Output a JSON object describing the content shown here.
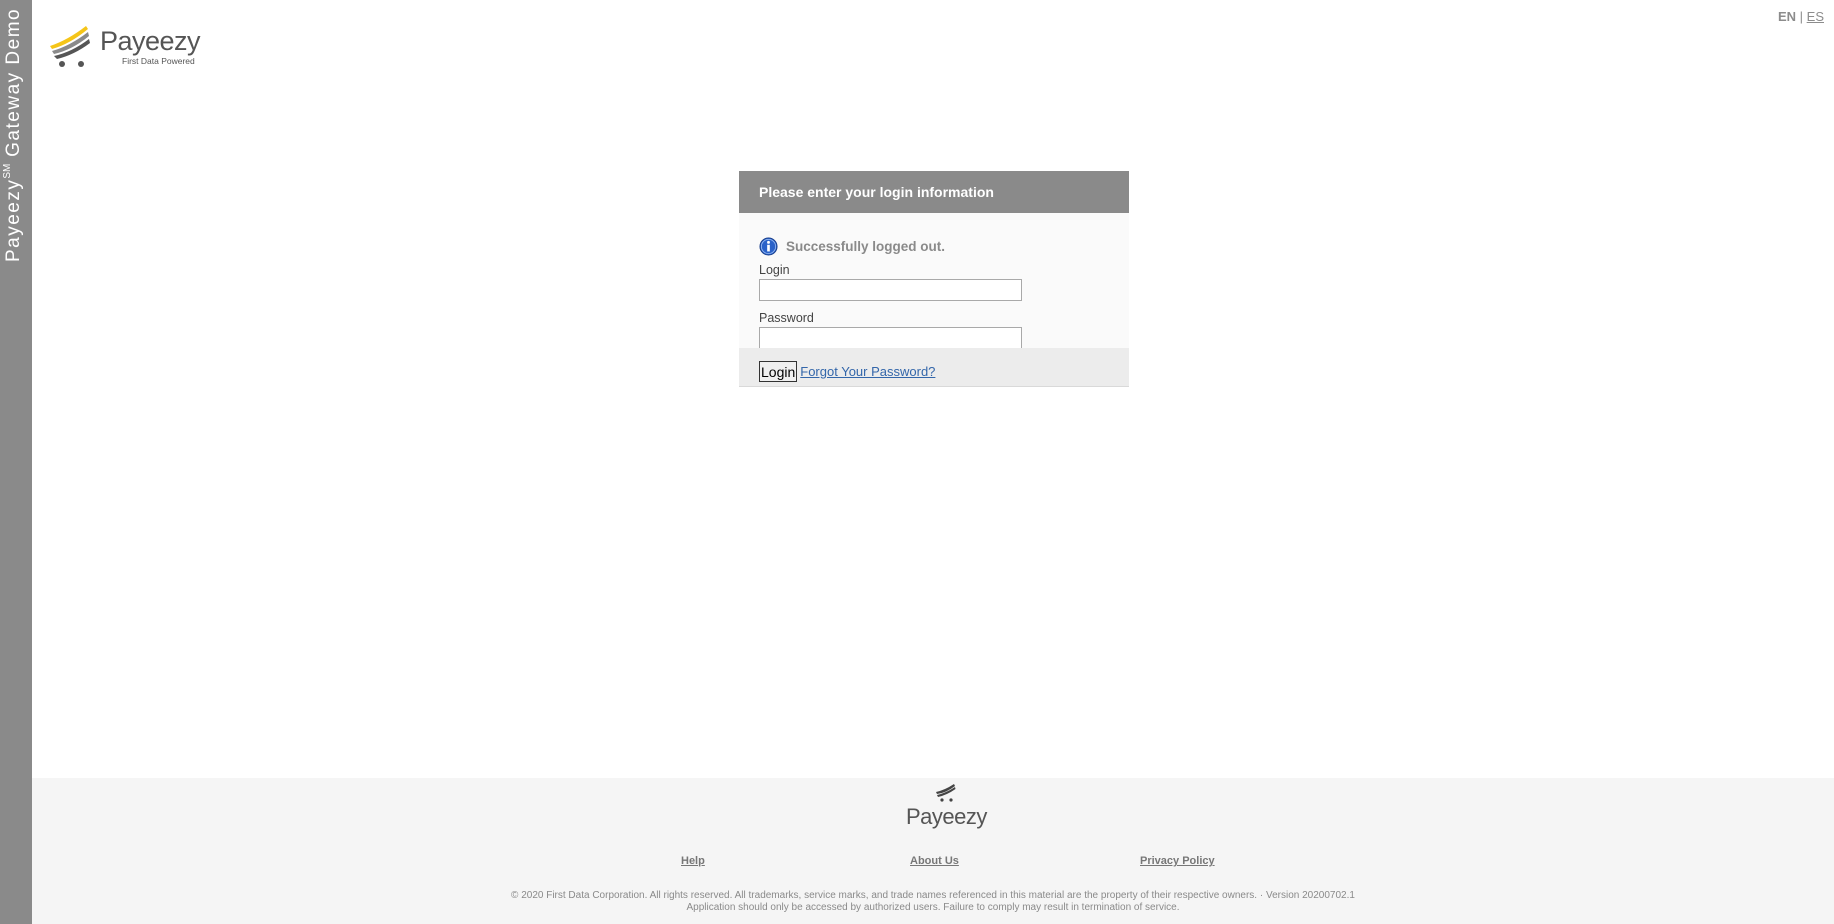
{
  "sidebar": {
    "brand": "Payeezy",
    "brand_mark": "SM",
    "suffix": " Gateway Demo"
  },
  "logo": {
    "name": "Payeezy",
    "tagline": "First Data Powered"
  },
  "language": {
    "current": "EN",
    "separator": "|",
    "other": "ES"
  },
  "login_panel": {
    "header": "Please enter your login information",
    "notice": "Successfully logged out.",
    "login_label": "Login",
    "login_value": "",
    "password_label": "Password",
    "password_value": "",
    "login_button": "Login",
    "forgot_link": "Forgot Your Password?"
  },
  "footer": {
    "logo": "Payeezy",
    "links": {
      "help": "Help",
      "about": "About Us",
      "privacy": "Privacy Policy"
    },
    "copyright_line1": "© 2020 First Data Corporation. All rights reserved. All trademarks, service marks, and trade names referenced in this material are the property of their respective owners. · Version 20200702.1",
    "copyright_line2": "Application should only be accessed by authorized users. Failure to comply may result in termination of service."
  },
  "colors": {
    "sidebar": "#8a8a8a",
    "panel_header": "#8a8a8a",
    "link": "#3366aa",
    "logo_yellow": "#f5c518",
    "info_blue": "#2a62c9"
  }
}
